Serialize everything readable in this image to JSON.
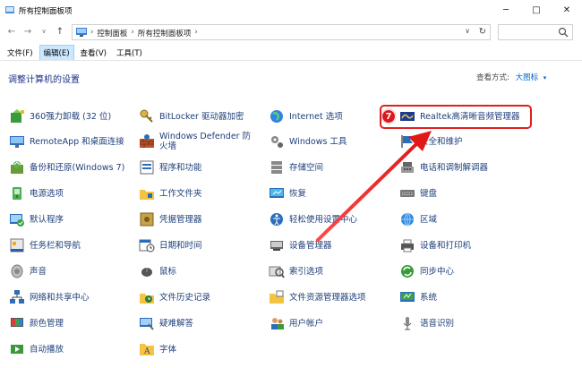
{
  "window": {
    "title": "所有控制面板项",
    "min": "─",
    "max": "□",
    "close": "✕"
  },
  "nav": {
    "back": "←",
    "forward": "→",
    "recent": "∨",
    "up": "↑"
  },
  "address": {
    "crumbs": [
      "控制面板",
      "所有控制面板项"
    ],
    "sep": "›",
    "dropdown": "∨",
    "refresh": "↻"
  },
  "search": {
    "placeholder": ""
  },
  "menu": {
    "file": "文件(F)",
    "edit": "编辑(E)",
    "view": "查看(V)",
    "tools": "工具(T)"
  },
  "content": {
    "heading": "调整计算机的设置",
    "viewby_label": "查看方式:",
    "viewby_value": "大图标",
    "viewby_caret": "▾"
  },
  "items": {
    "c1": [
      "360强力卸载 (32 位)",
      "RemoteApp 和桌面连接",
      "备份和还原(Windows 7)",
      "电源选项",
      "默认程序",
      "任务栏和导航",
      "声音",
      "网络和共享中心",
      "颜色管理",
      "自动播放"
    ],
    "c2": [
      "BitLocker 驱动器加密",
      "Windows Defender 防火墙",
      "程序和功能",
      "工作文件夹",
      "凭据管理器",
      "日期和时间",
      "鼠标",
      "文件历史记录",
      "疑难解答",
      "字体"
    ],
    "c3": [
      "Internet 选项",
      "Windows 工具",
      "存储空间",
      "恢复",
      "轻松使用设置中心",
      "设备管理器",
      "索引选项",
      "文件资源管理器选项",
      "用户帐户",
      ""
    ],
    "c4": [
      "Realtek高清晰音频管理器",
      "安全和维护",
      "电话和调制解调器",
      "键盘",
      "区域",
      "设备和打印机",
      "同步中心",
      "系统",
      "语音识别",
      ""
    ]
  },
  "annotation": {
    "step": "7",
    "color": "#e02020"
  }
}
